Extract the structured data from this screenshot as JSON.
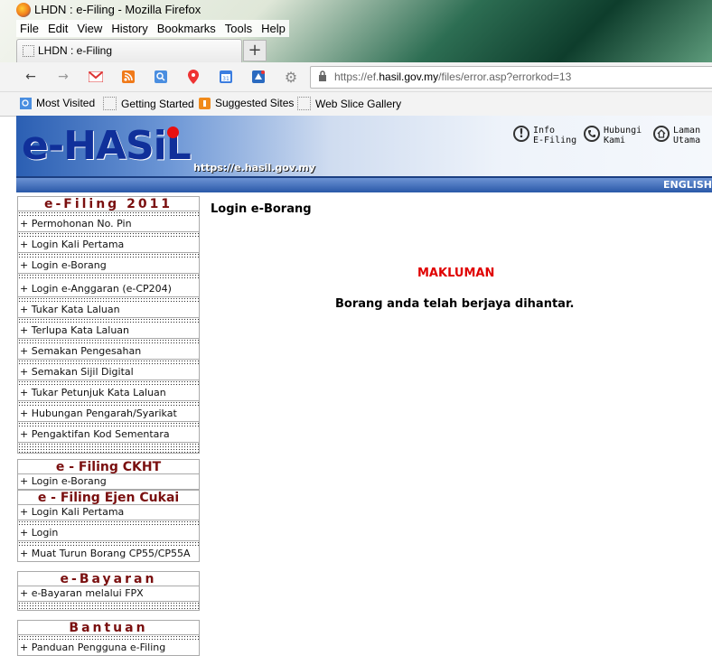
{
  "window": {
    "title": "LHDN : e-Filing - Mozilla Firefox"
  },
  "menu": [
    "File",
    "Edit",
    "View",
    "History",
    "Bookmarks",
    "Tools",
    "Help"
  ],
  "tab": {
    "label": "LHDN : e-Filing",
    "new_tab": "+"
  },
  "url": {
    "prefix": "https://ef.",
    "domain": "hasil.gov.my",
    "path": "/files/error.asp?errorkod=13"
  },
  "bookmarks": [
    "Most Visited",
    "Getting Started",
    "Suggested Sites",
    "Web Slice Gallery"
  ],
  "banner": {
    "logo": "e-HASiL",
    "url": "https://e.hasil.gov.my",
    "links": [
      {
        "line1": "Info",
        "line2": "E-Filing",
        "icon": "!"
      },
      {
        "line1": "Hubungi",
        "line2": "Kami",
        "icon": "phone"
      },
      {
        "line1": "Laman",
        "line2": "Utama",
        "icon": "home"
      }
    ],
    "language": "ENGLISH"
  },
  "sidebar": {
    "efiling": {
      "title": "e-Filing 2011",
      "items": [
        "+ Permohonan No. Pin",
        "+ Login Kali Pertama",
        "+ Login e-Borang",
        "+ Login e-Anggaran (e-CP204)",
        "+ Tukar Kata Laluan",
        "+ Terlupa Kata Laluan",
        "+ Semakan Pengesahan",
        "+ Semakan Sijil Digital",
        "+ Tukar Petunjuk Kata Laluan",
        "+ Hubungan Pengarah/Syarikat",
        "+ Pengaktifan Kod Sementara"
      ]
    },
    "ckht": {
      "title": "e - Filing CKHT",
      "items": [
        "+ Login e-Borang"
      ]
    },
    "ejen": {
      "title": "e - Filing Ejen Cukai",
      "items": [
        "+ Login Kali Pertama",
        "+ Login",
        "+ Muat Turun Borang CP55/CP55A"
      ]
    },
    "bayaran": {
      "title": "e-Bayaran",
      "items": [
        "+ e-Bayaran melalui FPX"
      ]
    },
    "bantuan": {
      "title": "Bantuan",
      "items": [
        "+ Panduan Pengguna e-Filing"
      ]
    }
  },
  "main": {
    "title": "Login e-Borang",
    "notice_label": "MAKLUMAN",
    "message": "Borang anda telah berjaya dihantar."
  }
}
